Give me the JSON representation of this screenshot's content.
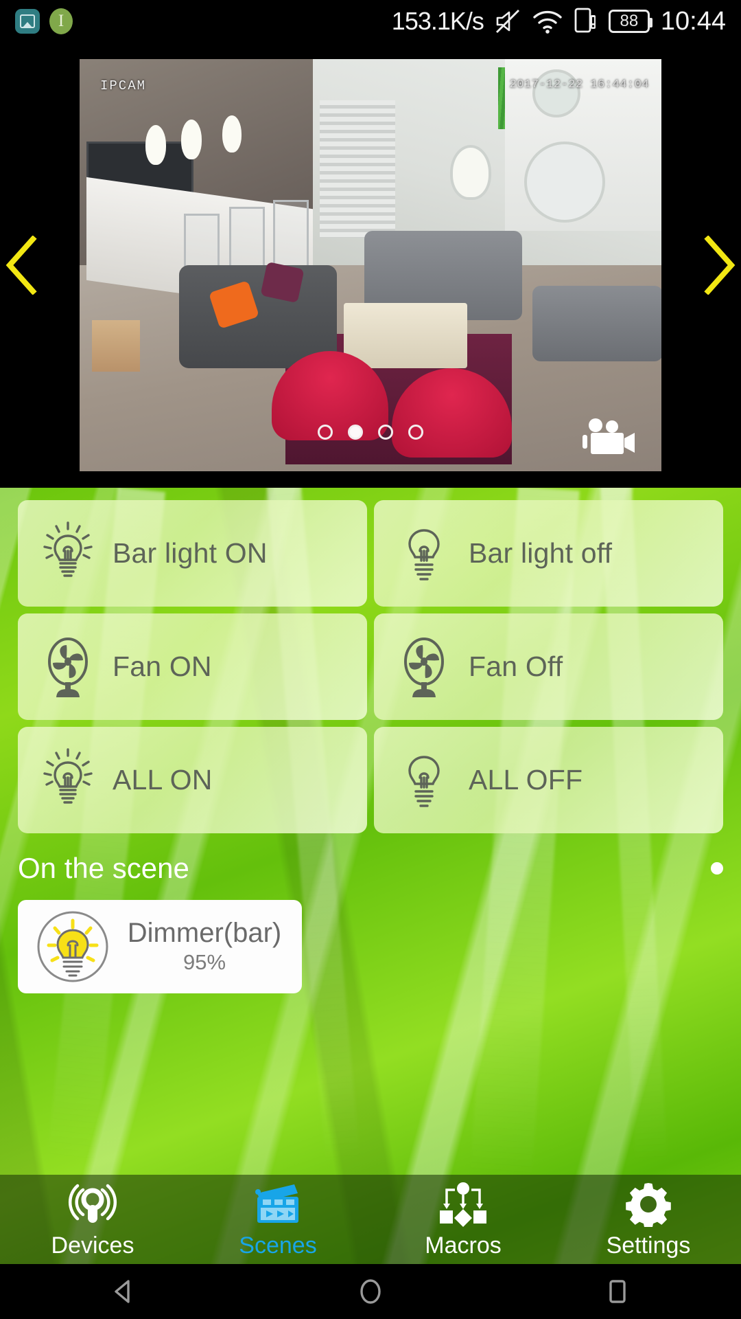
{
  "statusbar": {
    "network_speed": "153.1K/s",
    "clock": "10:44",
    "battery_level": "88",
    "icons": [
      "photo-icon",
      "info-icon",
      "mute-icon",
      "wifi-icon",
      "sim-card-icon",
      "battery-icon"
    ]
  },
  "camera": {
    "label": "IPCAM",
    "timestamp": "2017-12-22 16:44:04",
    "prev_arrow": "chevron-left-icon",
    "next_arrow": "chevron-right-icon",
    "record_icon": "video-camera-icon",
    "page_count": 4,
    "active_page": 2,
    "accent_arrow_color": "#f2e713"
  },
  "scene_buttons": [
    {
      "label": "Bar light ON",
      "icon": "lightbulb-on-icon"
    },
    {
      "label": "Bar light off",
      "icon": "lightbulb-off-icon"
    },
    {
      "label": "Fan ON",
      "icon": "fan-icon"
    },
    {
      "label": "Fan Off",
      "icon": "fan-icon"
    },
    {
      "label": "ALL ON",
      "icon": "lightbulb-on-icon"
    },
    {
      "label": "ALL OFF",
      "icon": "lightbulb-off-icon"
    }
  ],
  "section": {
    "title": "On the scene",
    "page_dot": "page-indicator-dot"
  },
  "device_card": {
    "name": "Dimmer(bar)",
    "value": "95%",
    "icon": "dimmer-bulb-icon",
    "bulb_color": "#f7e017"
  },
  "tabbar": {
    "active": "Scenes",
    "active_color": "#18a5e8",
    "items": [
      {
        "label": "Devices",
        "icon": "signal-broadcast-icon",
        "active": false
      },
      {
        "label": "Scenes",
        "icon": "clapperboard-icon",
        "active": true
      },
      {
        "label": "Macros",
        "icon": "flowchart-icon",
        "active": false
      },
      {
        "label": "Settings",
        "icon": "gear-icon",
        "active": false
      }
    ]
  },
  "system_nav": {
    "back": "back-triangle-icon",
    "home": "home-circle-icon",
    "recents": "recents-square-icon"
  }
}
